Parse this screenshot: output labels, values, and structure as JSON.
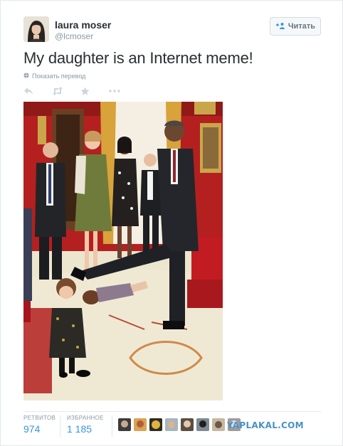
{
  "tweet": {
    "author_name": "laura moser",
    "author_handle": "@lcmoser",
    "follow_label": "Читать",
    "text": "My daughter is an Internet meme!",
    "translate_label": "Показать перевод"
  },
  "stats": {
    "retweets_label": "РЕТВИТОВ",
    "retweets_value": "974",
    "favorites_label": "ИЗБРАННОЕ",
    "favorites_value": "1 185"
  },
  "watermark": "YAPLAKAL.COM",
  "icons": {
    "reply": "reply-icon",
    "retweet": "retweet-icon",
    "favorite": "star-icon",
    "more": "more-icon",
    "follow": "add-user-icon",
    "translate": "globe-icon"
  },
  "colors": {
    "link": "#3b94d9",
    "muted": "#8899a6",
    "text": "#292f33",
    "watermark": "#4a90c8"
  }
}
